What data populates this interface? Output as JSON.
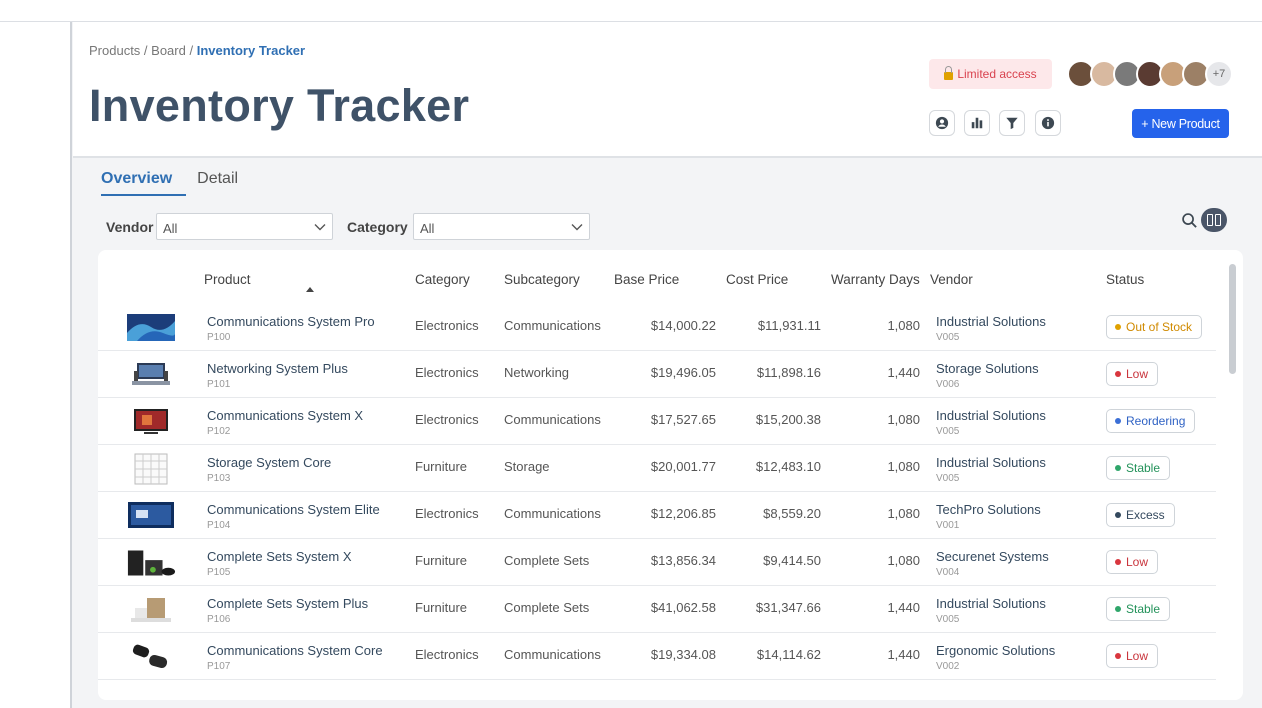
{
  "breadcrumb": {
    "items": [
      "Products",
      "Board"
    ],
    "separator": " / ",
    "current": "Inventory Tracker"
  },
  "page": {
    "title": "Inventory Tracker"
  },
  "access": {
    "label": "Limited access"
  },
  "avatars": {
    "colors": [
      "#6b4f3b",
      "#d8b9a0",
      "#7a7a7a",
      "#5a3b32",
      "#c8a07a",
      "#9c8066"
    ],
    "more_label": "+7"
  },
  "toolbar": {
    "icons": [
      "user-circle-icon",
      "bar-chart-icon",
      "filter-icon",
      "info-icon"
    ],
    "new_label": "+ New Product"
  },
  "tabs": [
    {
      "label": "Overview",
      "active": true
    },
    {
      "label": "Detail",
      "active": false
    }
  ],
  "filters": {
    "vendor": {
      "label": "Vendor",
      "value": "All"
    },
    "category": {
      "label": "Category",
      "value": "All"
    }
  },
  "table": {
    "columns": [
      "Product",
      "Category",
      "Subcategory",
      "Base Price",
      "Cost Price",
      "Warranty Days",
      "Vendor",
      "Status"
    ],
    "sorted_by": "Product",
    "rows": [
      {
        "thumb": "tv",
        "product": "Communications System Pro",
        "id": "P100",
        "category": "Electronics",
        "subcategory": "Communications",
        "base": "$14,000.22",
        "cost": "$11,931.11",
        "warranty": "1,080",
        "vendor": "Industrial Solutions",
        "vendor_id": "V005",
        "status": "Out of Stock",
        "status_color": "#e0a100",
        "status_text_color": "#d08a00"
      },
      {
        "thumb": "setup",
        "product": "Networking System Plus",
        "id": "P101",
        "category": "Electronics",
        "subcategory": "Networking",
        "base": "$19,496.05",
        "cost": "$11,898.16",
        "warranty": "1,440",
        "vendor": "Storage Solutions",
        "vendor_id": "V006",
        "status": "Low",
        "status_color": "#d9363e",
        "status_text_color": "#c9353d"
      },
      {
        "thumb": "tv2",
        "product": "Communications System X",
        "id": "P102",
        "category": "Electronics",
        "subcategory": "Communications",
        "base": "$17,527.65",
        "cost": "$15,200.38",
        "warranty": "1,080",
        "vendor": "Industrial Solutions",
        "vendor_id": "V005",
        "status": "Reordering",
        "status_color": "#3b6fd6",
        "status_text_color": "#2f62c4"
      },
      {
        "thumb": "grid",
        "product": "Storage System Core",
        "id": "P103",
        "category": "Furniture",
        "subcategory": "Storage",
        "base": "$20,001.77",
        "cost": "$12,483.10",
        "warranty": "1,080",
        "vendor": "Industrial Solutions",
        "vendor_id": "V005",
        "status": "Stable",
        "status_color": "#2fa66a",
        "status_text_color": "#23925a"
      },
      {
        "thumb": "screen",
        "product": "Communications System Elite",
        "id": "P104",
        "category": "Electronics",
        "subcategory": "Communications",
        "base": "$12,206.85",
        "cost": "$8,559.20",
        "warranty": "1,080",
        "vendor": "TechPro Solutions",
        "vendor_id": "V001",
        "status": "Excess",
        "status_color": "#34495e",
        "status_text_color": "#34495e"
      },
      {
        "thumb": "console",
        "product": "Complete Sets System X",
        "id": "P105",
        "category": "Furniture",
        "subcategory": "Complete Sets",
        "base": "$13,856.34",
        "cost": "$9,414.50",
        "warranty": "1,080",
        "vendor": "Securenet Systems",
        "vendor_id": "V004",
        "status": "Low",
        "status_color": "#d9363e",
        "status_text_color": "#c9353d"
      },
      {
        "thumb": "boxes",
        "product": "Complete Sets System Plus",
        "id": "P106",
        "category": "Furniture",
        "subcategory": "Complete Sets",
        "base": "$41,062.58",
        "cost": "$31,347.66",
        "warranty": "1,440",
        "vendor": "Industrial Solutions",
        "vendor_id": "V005",
        "status": "Stable",
        "status_color": "#2fa66a",
        "status_text_color": "#23925a"
      },
      {
        "thumb": "cameras",
        "product": "Communications System Core",
        "id": "P107",
        "category": "Electronics",
        "subcategory": "Communications",
        "base": "$19,334.08",
        "cost": "$14,114.62",
        "warranty": "1,440",
        "vendor": "Ergonomic Solutions",
        "vendor_id": "V002",
        "status": "Low",
        "status_color": "#d9363e",
        "status_text_color": "#c9353d"
      }
    ]
  }
}
